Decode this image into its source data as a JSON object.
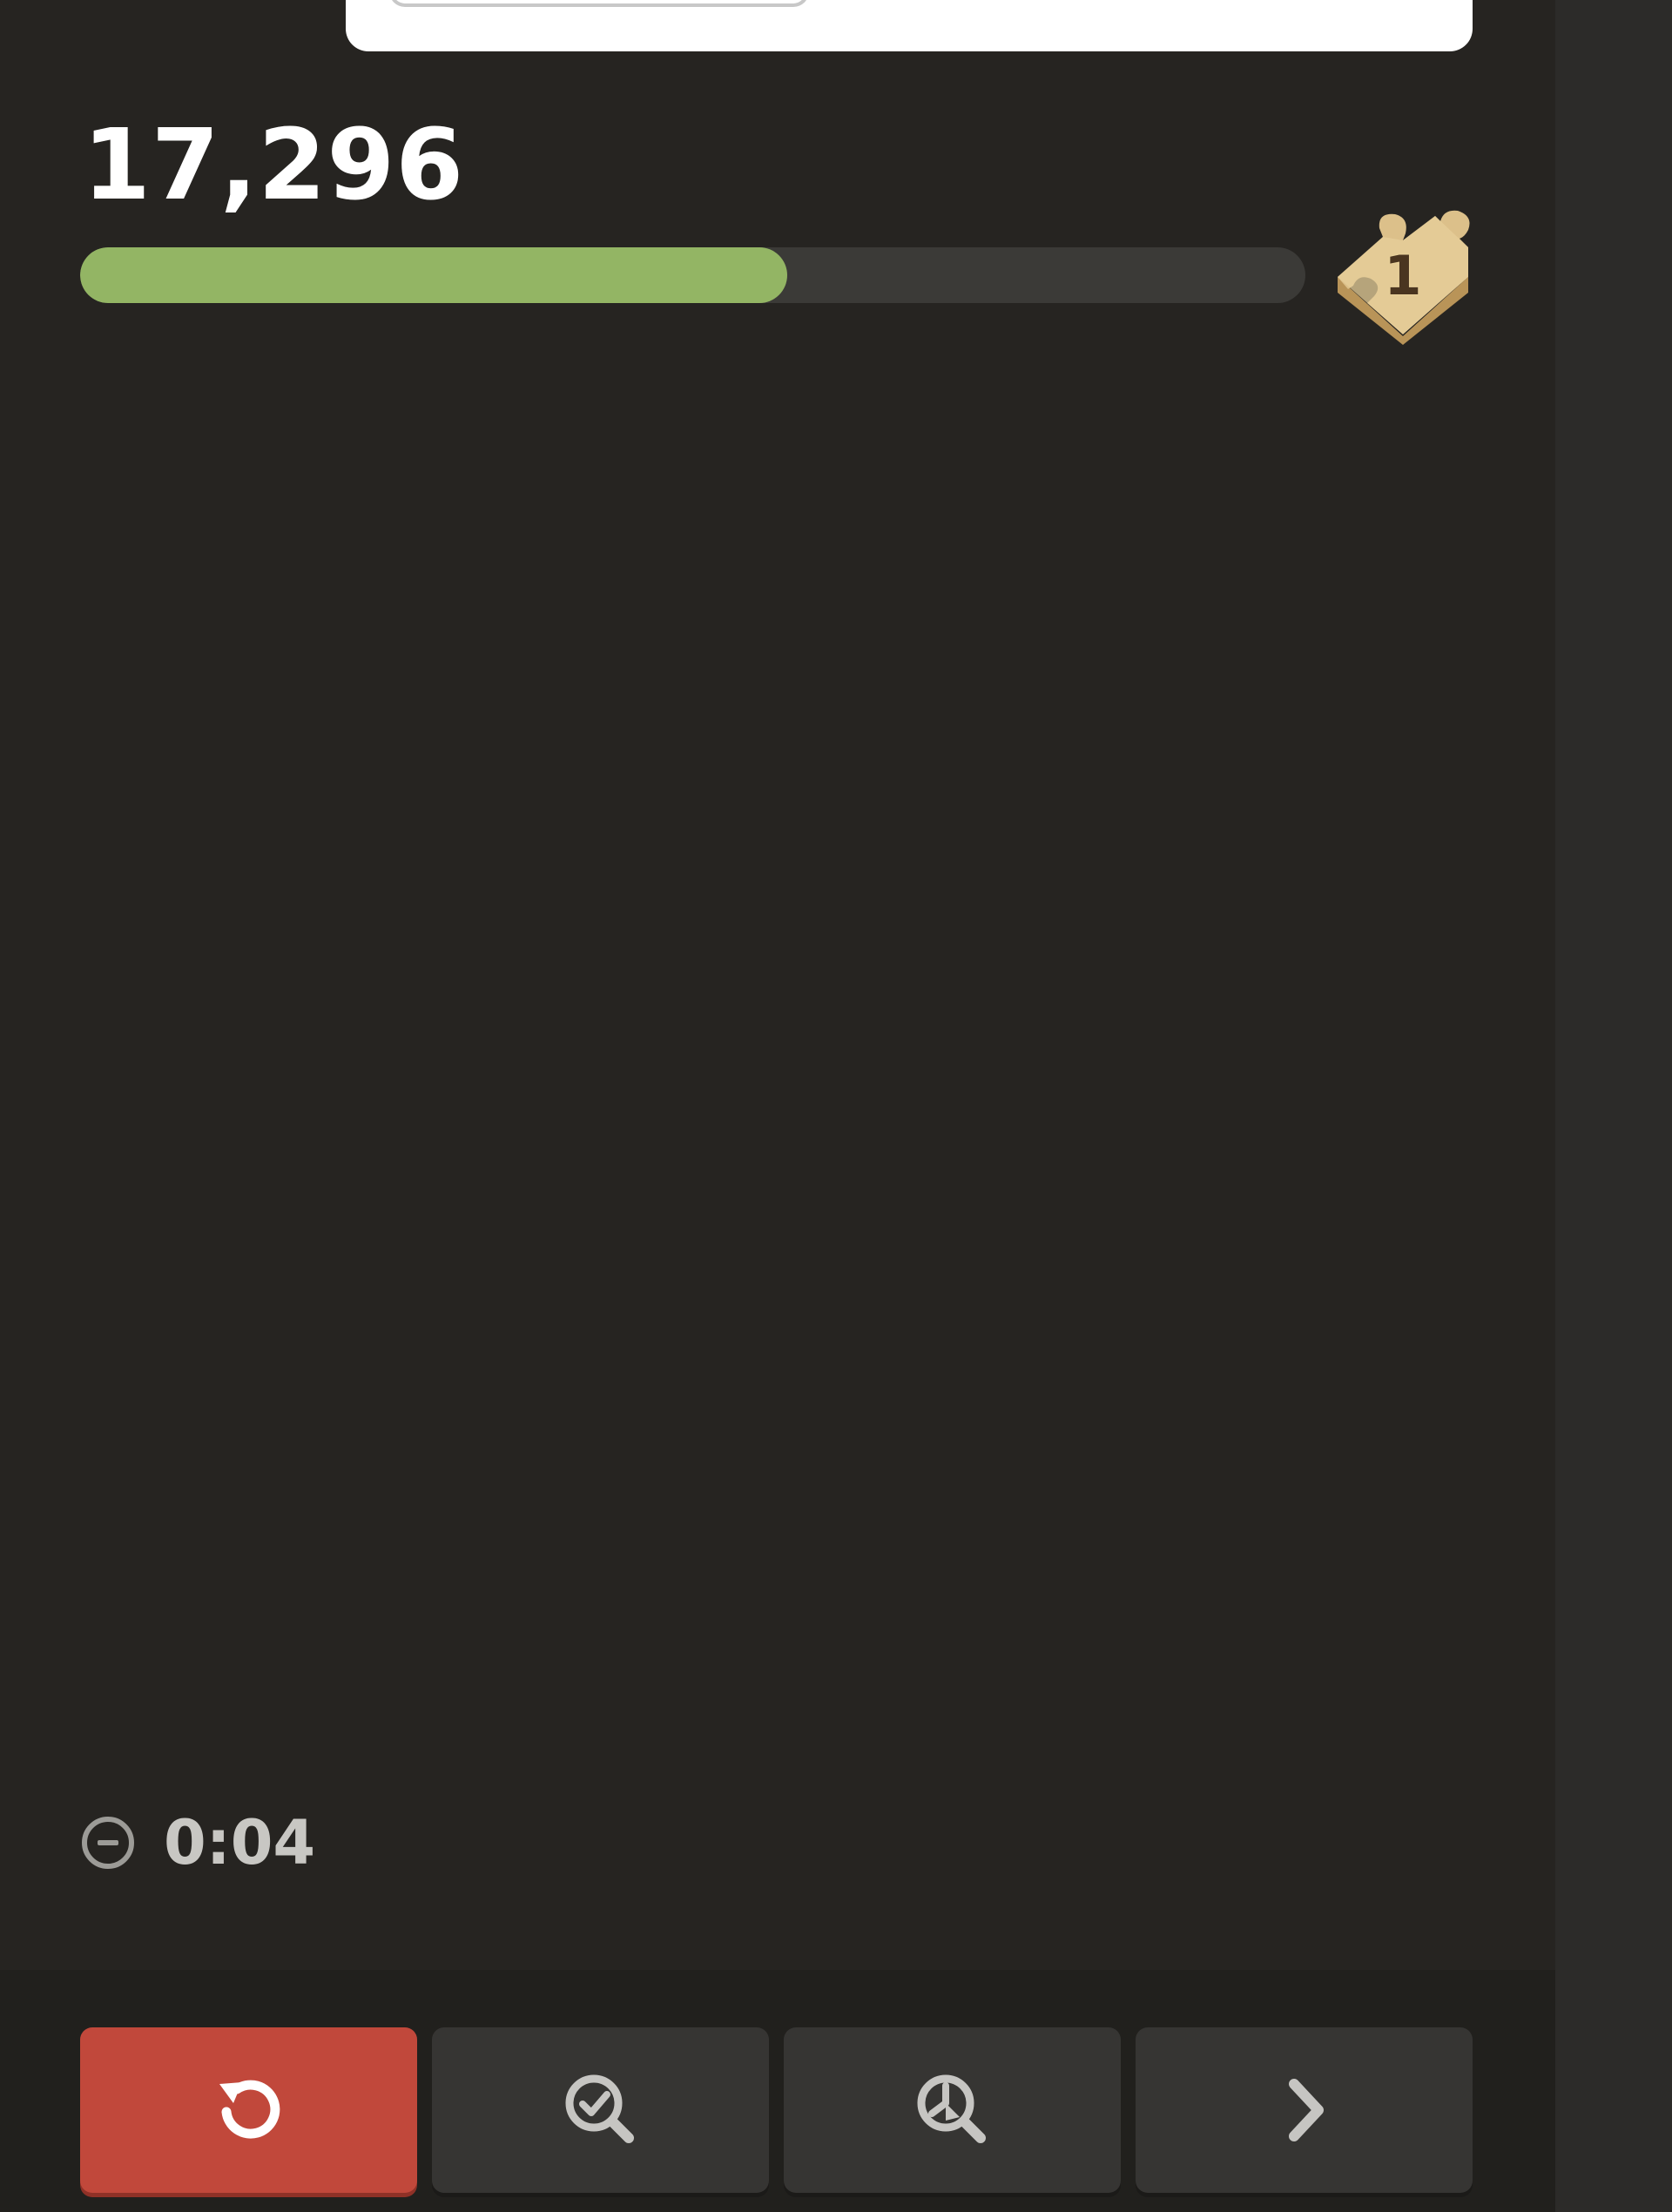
{
  "score": "17,296",
  "progress": {
    "fraction": 0.577,
    "fill_color": "#93b564",
    "track_color": "#3b3a37"
  },
  "badge": {
    "icon": "puzzle-piece-icon",
    "count": "1"
  },
  "timer": {
    "icon": "minus-circle-icon",
    "value": "0:04"
  },
  "controls": [
    {
      "icon": "retry-icon",
      "color": "#c1483b"
    },
    {
      "icon": "hint-magnifier-check-icon",
      "color": "#363533"
    },
    {
      "icon": "analysis-magnifier-icon",
      "color": "#363533"
    },
    {
      "icon": "chevron-right-icon",
      "color": "#363533"
    }
  ]
}
